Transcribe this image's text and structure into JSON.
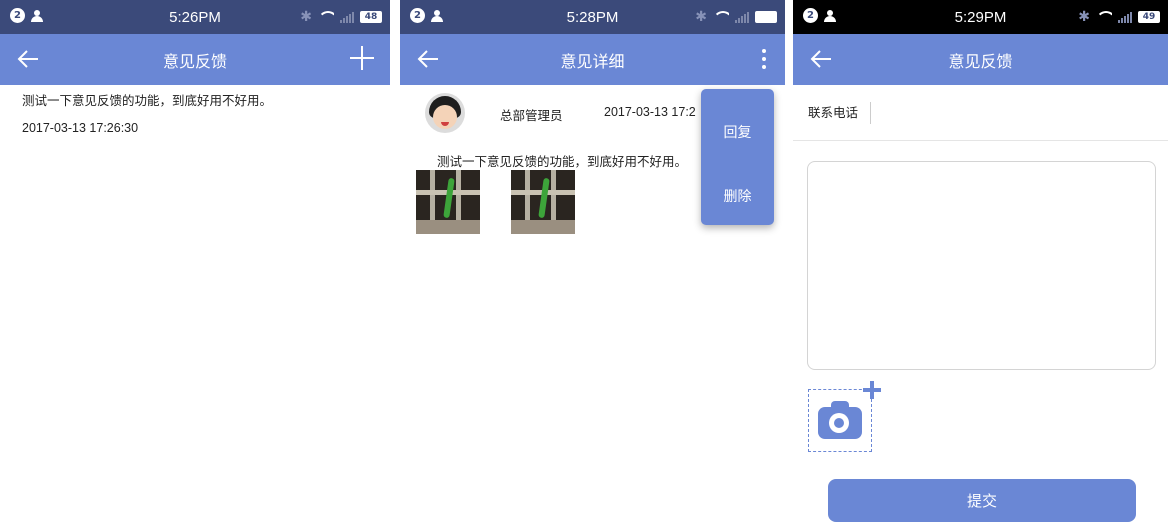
{
  "colors": {
    "accent": "#6a87d5",
    "status_bar_1": "#3b4a7a",
    "status_bar_3": "#000000"
  },
  "screen1": {
    "status": {
      "badge": "2",
      "time": "5:26PM",
      "battery": "48"
    },
    "title": "意见反馈",
    "feedback": {
      "text": "测试一下意见反馈的功能，到底好用不好用。",
      "date": "2017-03-13 17:26:30"
    }
  },
  "screen2": {
    "status": {
      "badge": "2",
      "time": "5:28PM",
      "battery": ""
    },
    "title": "意见详细",
    "author": "总部管理员",
    "date": "2017-03-13 17:2",
    "text": "测试一下意见反馈的功能，到底好用不好用。",
    "menu": {
      "reply": "回复",
      "delete": "删除"
    }
  },
  "screen3": {
    "status": {
      "badge": "2",
      "time": "5:29PM",
      "battery": "49"
    },
    "title": "意见反馈",
    "phone_label": "联系电话",
    "phone_value": "",
    "content_value": "",
    "submit_label": "提交"
  }
}
